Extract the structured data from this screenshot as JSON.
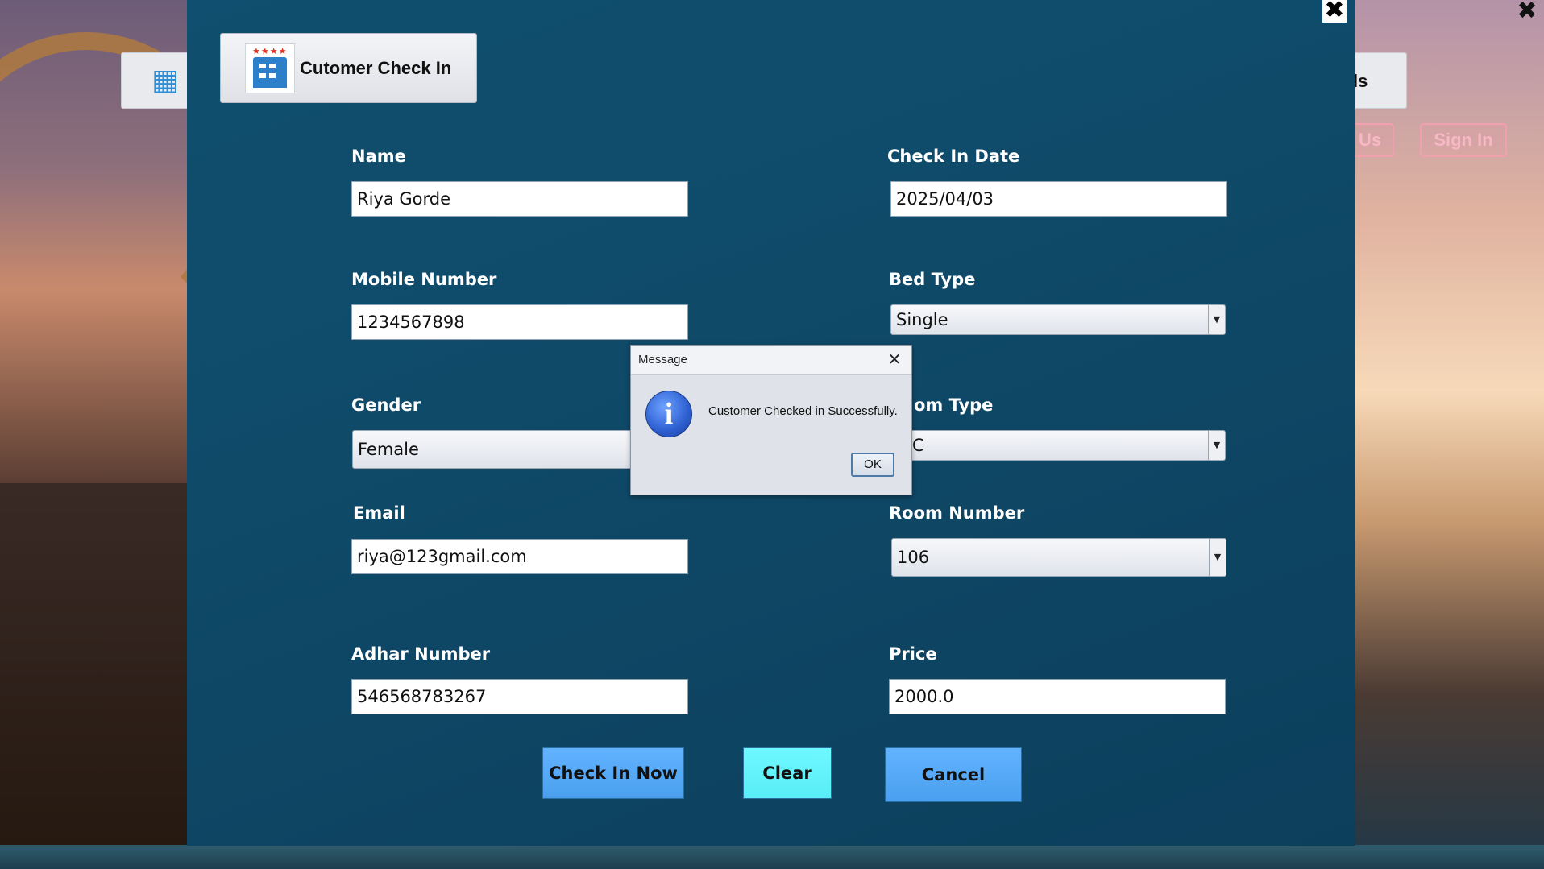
{
  "background_window": {
    "button_fragment": "ls",
    "pill_left_fragment": "Us",
    "sign_in_label": "Sign In",
    "close_glyph": "✖"
  },
  "dialog": {
    "title": "Cutomer Check In",
    "close_glyph": "✖"
  },
  "form": {
    "name": {
      "label": "Name",
      "value": "Riya Gorde"
    },
    "mobile": {
      "label": "Mobile Number",
      "value": "1234567898"
    },
    "gender": {
      "label": "Gender",
      "value": "Female"
    },
    "email": {
      "label": "Email",
      "value": "riya@123gmail.com"
    },
    "adhar": {
      "label": "Adhar Number",
      "value": "546568783267"
    },
    "check_in_date": {
      "label": "Check In Date",
      "value": "2025/04/03"
    },
    "bed_type": {
      "label": "Bed Type",
      "value": "Single"
    },
    "room_type": {
      "label_visible": "om Type",
      "value_visible": "C"
    },
    "room_number": {
      "label": "Room Number",
      "value": "106"
    },
    "price": {
      "label": "Price",
      "value": "2000.0"
    }
  },
  "buttons": {
    "check_in": "Check In Now",
    "clear": "Clear",
    "cancel": "Cancel"
  },
  "message_box": {
    "title": "Message",
    "text": "Customer Checked in Successfully.",
    "ok": "OK",
    "close_glyph": "✕",
    "info_glyph": "i"
  },
  "icons": {
    "dropdown": "▼"
  },
  "colors": {
    "panel": "#0f4a69",
    "primary_button": "#4aa0ef",
    "clear_button": "#58eef7"
  }
}
